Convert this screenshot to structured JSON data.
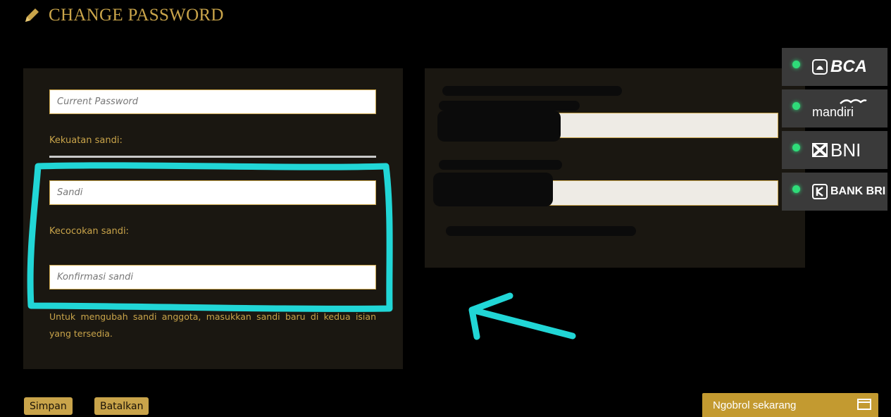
{
  "page": {
    "title": "CHANGE PASSWORD"
  },
  "form": {
    "current_password_placeholder": "Current Password",
    "strength_label": "Kekuatan sandi:",
    "password_placeholder": "Sandi",
    "match_label": "Kecocokan sandi:",
    "confirm_placeholder": "Konfirmasi sandi",
    "help_text": "Untuk mengubah sandi anggota, masukkan sandi baru di kedua isian yang tersedia."
  },
  "banks": [
    {
      "name": "BCA",
      "status": "online"
    },
    {
      "name": "mandiri",
      "status": "online"
    },
    {
      "name": "BNI",
      "status": "online"
    },
    {
      "name": "BANK BRI",
      "status": "online"
    }
  ],
  "buttons": {
    "save": "Simpan",
    "cancel": "Batalkan"
  },
  "chat": {
    "label": "Ngobrol sekarang"
  },
  "colors": {
    "accent": "#c9a44a",
    "panel": "#1a1711",
    "annotation": "#21d6d6",
    "status_online": "#2fdc79"
  }
}
